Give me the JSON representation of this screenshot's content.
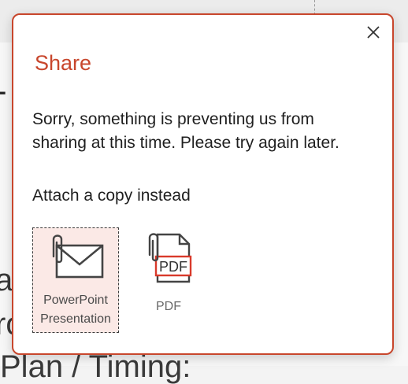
{
  "background": {
    "glyph_dash": "-",
    "fragment_a": "a",
    "fragment_ro": "ro",
    "fragment_plan": "Plan / Timing:"
  },
  "dialog": {
    "title": "Share",
    "message": "Sorry, something is preventing us from sharing at this time. Please try again later.",
    "attach_heading": "Attach a copy instead",
    "close_icon": "close-icon",
    "options": [
      {
        "label": "PowerPoint Presentation",
        "icon": "email-attachment-icon",
        "selected": true
      },
      {
        "label": "PDF",
        "icon": "pdf-attachment-icon",
        "selected": false
      }
    ],
    "pdf_icon_text": "PDF"
  },
  "colors": {
    "accent": "#c8462c",
    "selected_bg": "#fbe9e6",
    "text": "#1f1f1f"
  }
}
